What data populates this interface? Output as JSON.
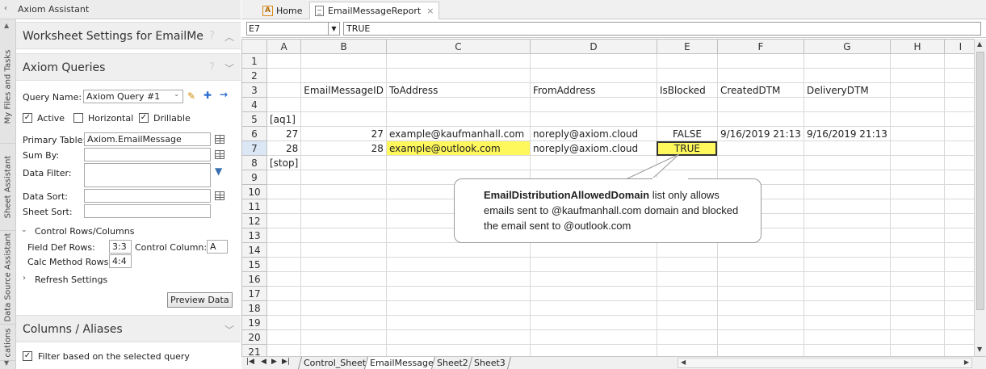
{
  "panel": {
    "header_title": "Axiom Assistant",
    "vertical_tabs": [
      "My Files and Tasks",
      "Sheet Assistant",
      "Data Source Assistant",
      "cations"
    ],
    "worksheet_settings": {
      "title": "Worksheet Settings for EmailMe",
      "help": "?"
    },
    "axiom_queries": {
      "title": "Axiom Queries",
      "help": "?",
      "query_name_label": "Query Name:",
      "query_name_value": "Axiom Query #1",
      "active_label": "Active",
      "active_checked": "✓",
      "horizontal_label": "Horizontal",
      "drillable_label": "Drillable",
      "drillable_checked": "✓",
      "primary_table_label": "Primary Table:",
      "primary_table_value": "Axiom.EmailMessage",
      "sum_by_label": "Sum By:",
      "data_filter_label": "Data Filter:",
      "data_sort_label": "Data Sort:",
      "sheet_sort_label": "Sheet Sort:",
      "control_rows_label": "Control Rows/Columns",
      "field_def_rows_label": "Field Def Rows:",
      "field_def_rows_value": "3:3",
      "control_column_label": "Control Column:",
      "control_column_value": "A",
      "calc_method_rows_label": "Calc Method Rows:",
      "calc_method_rows_value": "4:4",
      "refresh_settings_label": "Refresh Settings",
      "preview_button": "Preview Data"
    },
    "columns_aliases": {
      "title": "Columns / Aliases",
      "filter_label": "Filter based on the selected query",
      "filter_checked": "✓"
    }
  },
  "tabs": {
    "home": "Home",
    "home_icon_letter": "A",
    "report": "EmailMessageReport",
    "close": "×"
  },
  "formula_bar": {
    "name_box": "E7",
    "formula": "TRUE"
  },
  "sheet": {
    "columns": [
      "A",
      "B",
      "C",
      "D",
      "E",
      "F",
      "G",
      "H",
      "I"
    ],
    "rows": [
      {
        "n": "1",
        "cells": [
          "",
          "",
          "",
          "",
          "",
          "",
          "",
          "",
          ""
        ]
      },
      {
        "n": "2",
        "cells": [
          "",
          "",
          "",
          "",
          "",
          "",
          "",
          "",
          ""
        ]
      },
      {
        "n": "3",
        "cells": [
          "",
          "EmailMessageID",
          "ToAddress",
          "FromAddress",
          "IsBlocked",
          "CreatedDTM",
          "DeliveryDTM",
          "",
          ""
        ]
      },
      {
        "n": "4",
        "cells": [
          "",
          "",
          "",
          "",
          "",
          "",
          "",
          "",
          ""
        ]
      },
      {
        "n": "5",
        "cells": [
          "[aq1]",
          "",
          "",
          "",
          "",
          "",
          "",
          "",
          ""
        ]
      },
      {
        "n": "6",
        "cells": [
          "27",
          "27",
          "example@kaufmanhall.com",
          "noreply@axiom.cloud",
          "FALSE",
          "9/16/2019 21:13",
          "9/16/2019 21:13",
          "",
          ""
        ]
      },
      {
        "n": "7",
        "cells": [
          "28",
          "28",
          "example@outlook.com",
          "noreply@axiom.cloud",
          "TRUE",
          "",
          "",
          "",
          ""
        ]
      },
      {
        "n": "8",
        "cells": [
          "[stop]",
          "",
          "",
          "",
          "",
          "",
          "",
          "",
          ""
        ]
      },
      {
        "n": "9",
        "cells": [
          "",
          "",
          "",
          "",
          "",
          "",
          "",
          "",
          ""
        ]
      },
      {
        "n": "10",
        "cells": [
          "",
          "",
          "",
          "",
          "",
          "",
          "",
          "",
          ""
        ]
      },
      {
        "n": "11",
        "cells": [
          "",
          "",
          "",
          "",
          "",
          "",
          "",
          "",
          ""
        ]
      },
      {
        "n": "12",
        "cells": [
          "",
          "",
          "",
          "",
          "",
          "",
          "",
          "",
          ""
        ]
      },
      {
        "n": "13",
        "cells": [
          "",
          "",
          "",
          "",
          "",
          "",
          "",
          "",
          ""
        ]
      },
      {
        "n": "14",
        "cells": [
          "",
          "",
          "",
          "",
          "",
          "",
          "",
          "",
          ""
        ]
      },
      {
        "n": "15",
        "cells": [
          "",
          "",
          "",
          "",
          "",
          "",
          "",
          "",
          ""
        ]
      },
      {
        "n": "16",
        "cells": [
          "",
          "",
          "",
          "",
          "",
          "",
          "",
          "",
          ""
        ]
      },
      {
        "n": "17",
        "cells": [
          "",
          "",
          "",
          "",
          "",
          "",
          "",
          "",
          ""
        ]
      },
      {
        "n": "18",
        "cells": [
          "",
          "",
          "",
          "",
          "",
          "",
          "",
          "",
          ""
        ]
      },
      {
        "n": "19",
        "cells": [
          "",
          "",
          "",
          "",
          "",
          "",
          "",
          "",
          ""
        ]
      },
      {
        "n": "20",
        "cells": [
          "",
          "",
          "",
          "",
          "",
          "",
          "",
          "",
          ""
        ]
      },
      {
        "n": "21",
        "cells": [
          "",
          "",
          "",
          "",
          "",
          "",
          "",
          "",
          ""
        ]
      }
    ],
    "highlight_color": "#fff85c"
  },
  "callout": {
    "bold": "EmailDistributionAllowedDomain",
    "text": " list only allows emails sent to @kaufmanhall.com domain and blocked the email sent to @outlook.com"
  },
  "sheet_tabs": [
    "Control_Sheet",
    "EmailMessage",
    "Sheet2",
    "Sheet3"
  ],
  "active_sheet": "EmailMessage"
}
